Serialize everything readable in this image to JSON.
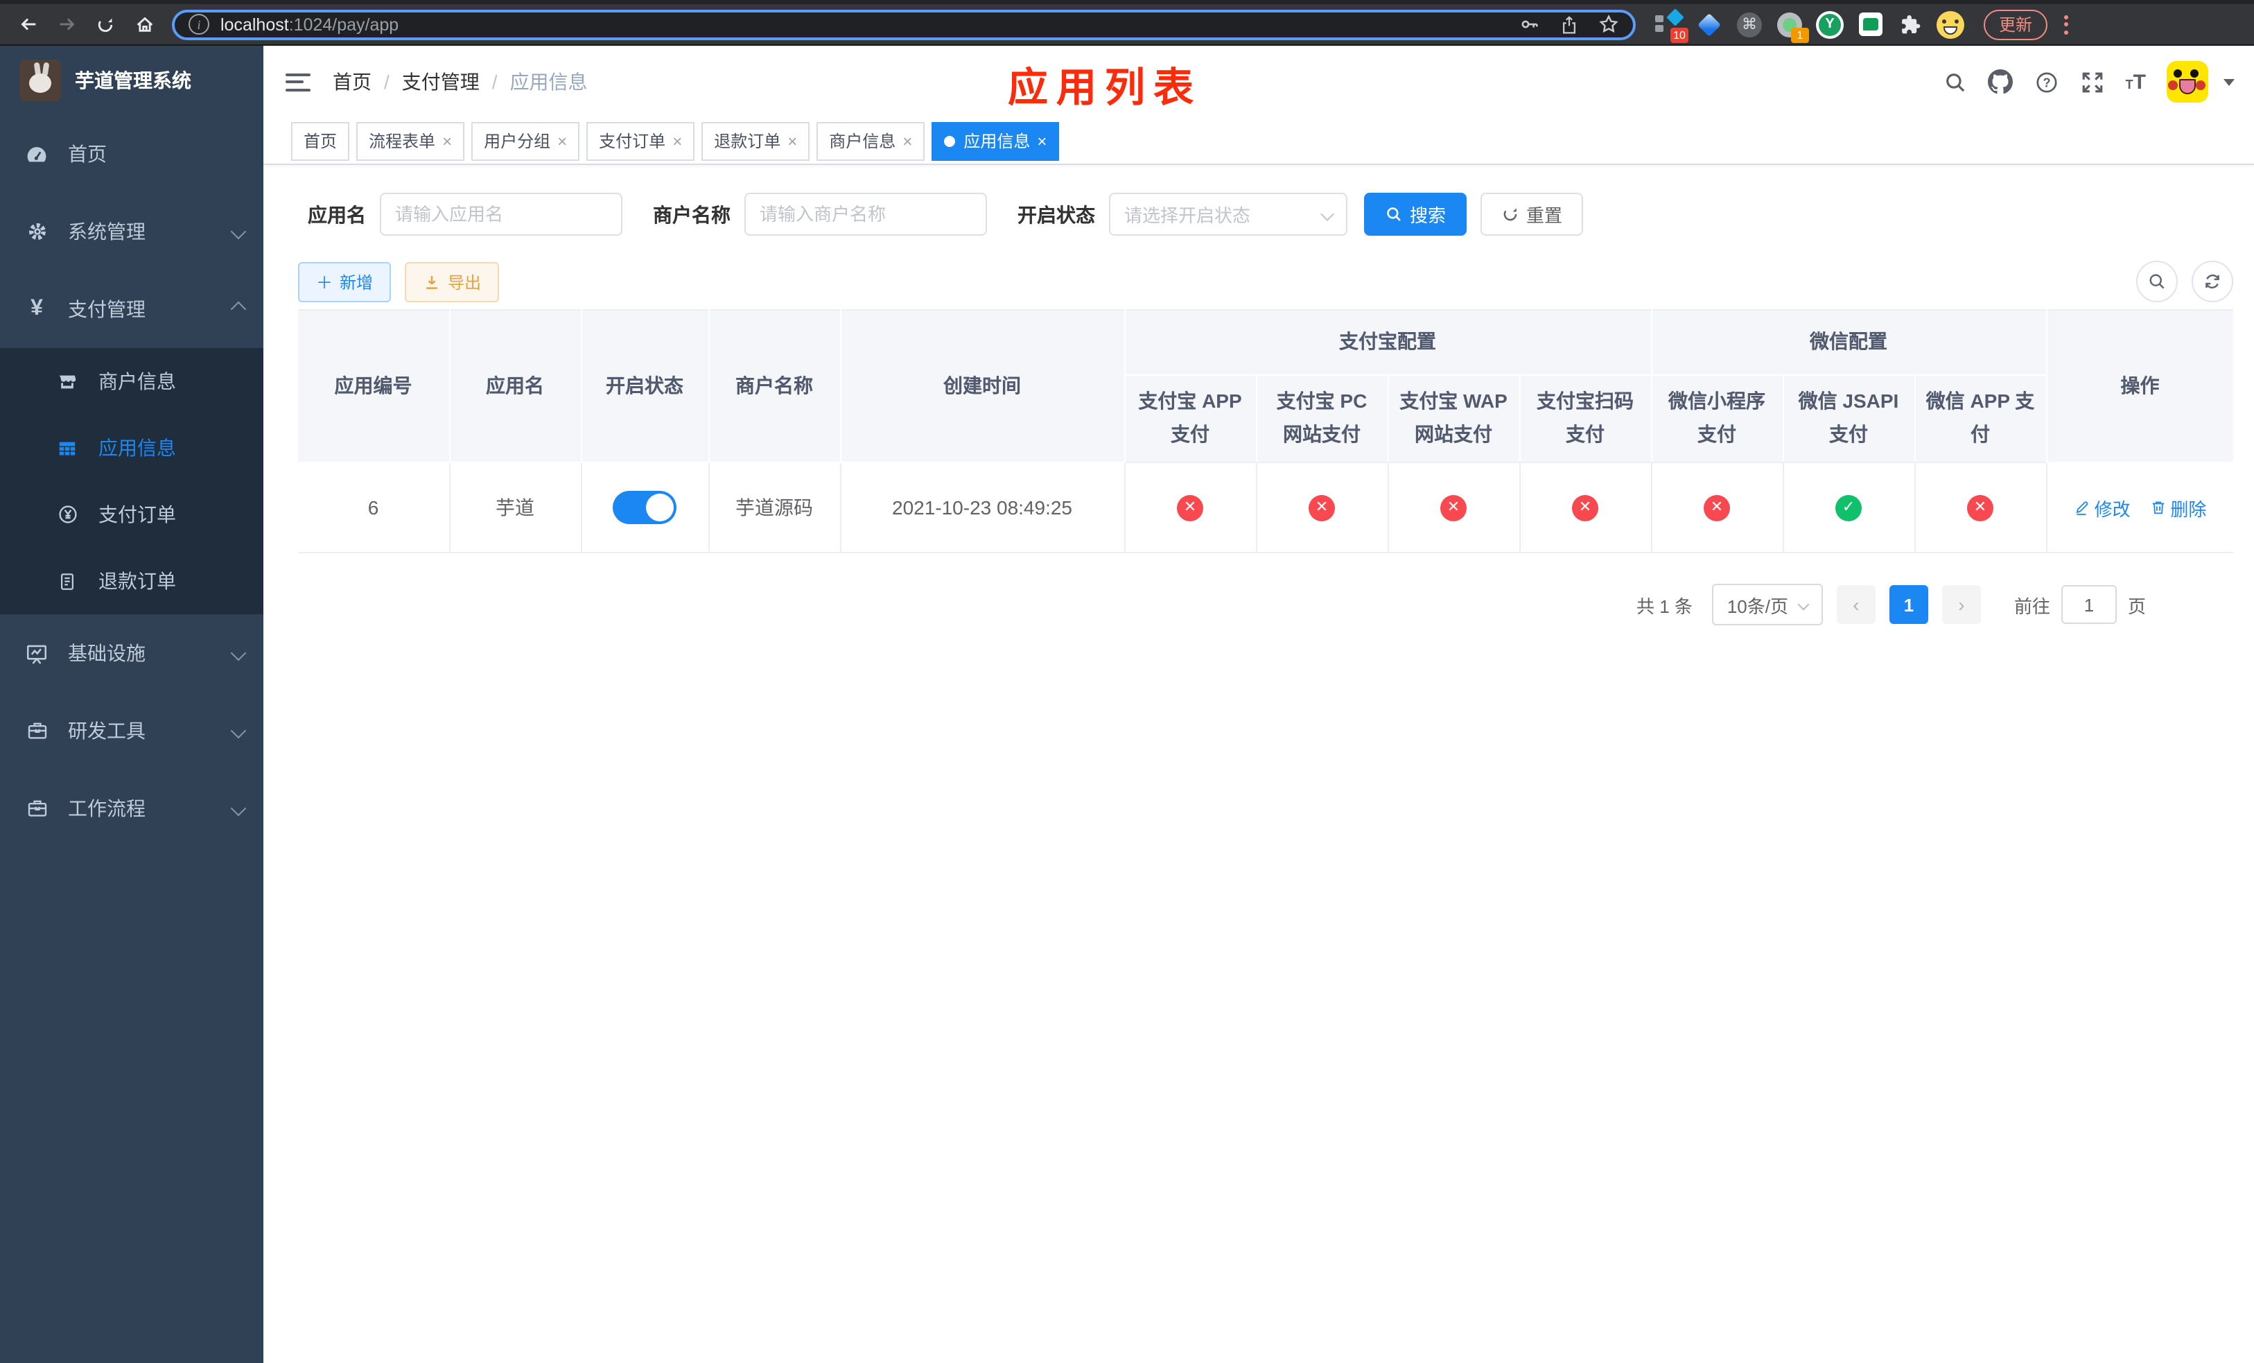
{
  "colors": {
    "primary": "#1b87f2",
    "danger": "#f7494f",
    "success": "#11c06a",
    "warning": "#e6a23c",
    "annotation": "#fb2c0c"
  },
  "ui": {
    "close_glyph": "×",
    "check_glyph": "✓",
    "cross_glyph": "✕",
    "breadcrumb_sep": "/",
    "prev_glyph": "‹",
    "next_glyph": "›",
    "cmd_glyph": "⌘",
    "plus_glyph": "＋",
    "info_glyph": "i",
    "help_glyph": "?",
    "font_icon_small": "T",
    "font_icon_big": "T",
    "yen_glyph": "¥"
  },
  "chrome": {
    "url_host": "localhost",
    "url_path": ":1024/pay/app",
    "ext_badge_blue": "10",
    "ext_badge_green": "1",
    "ext_y_label": "Y",
    "update_label": "更新"
  },
  "sidebar": {
    "title": "芋道管理系统",
    "menu_top": [
      {
        "label": "首页",
        "icon": "dashboard-icon"
      },
      {
        "label": "系统管理",
        "icon": "gear-icon"
      },
      {
        "label": "支付管理",
        "icon": "yen-icon"
      }
    ],
    "submenu": [
      {
        "label": "商户信息",
        "icon": "shop-icon"
      },
      {
        "label": "应用信息",
        "icon": "grid-icon"
      },
      {
        "label": "支付订单",
        "icon": "yen-circle-icon"
      },
      {
        "label": "退款订单",
        "icon": "document-icon"
      }
    ],
    "menu_bottom": [
      {
        "label": "基础设施",
        "icon": "monitor-icon"
      },
      {
        "label": "研发工具",
        "icon": "briefcase-icon"
      },
      {
        "label": "工作流程",
        "icon": "briefcase-icon"
      }
    ]
  },
  "navbar": {
    "breadcrumb": [
      "首页",
      "支付管理",
      "应用信息"
    ],
    "annotation": "应用列表"
  },
  "tabs": [
    {
      "label": "首页"
    },
    {
      "label": "流程表单"
    },
    {
      "label": "用户分组"
    },
    {
      "label": "支付订单"
    },
    {
      "label": "退款订单"
    },
    {
      "label": "商户信息"
    },
    {
      "label": "应用信息"
    }
  ],
  "filters": {
    "app_name_label": "应用名",
    "app_name_placeholder": "请输入应用名",
    "merchant_label": "商户名称",
    "merchant_placeholder": "请输入商户名称",
    "status_label": "开启状态",
    "status_placeholder": "请选择开启状态",
    "search_label": "搜索",
    "reset_label": "重置"
  },
  "toolbar": {
    "add_label": "新增",
    "export_label": "导出"
  },
  "table": {
    "columns": [
      "应用编号",
      "应用名",
      "开启状态",
      "商户名称",
      "创建时间"
    ],
    "alipay_group": {
      "label": "支付宝配置",
      "children": [
        "支付宝 APP 支付",
        "支付宝 PC 网站支付",
        "支付宝 WAP 网站支付",
        "支付宝扫码支付"
      ]
    },
    "wechat_group": {
      "label": "微信配置",
      "children": [
        "微信小程序支付",
        "微信 JSAPI 支付",
        "微信 APP 支付"
      ]
    },
    "actions_label": "操作",
    "row": {
      "id": "6",
      "name": "芋道",
      "enabled": true,
      "merchant": "芋道源码",
      "created_at": "2021-10-23 08:49:25",
      "statuses": [
        "no",
        "no",
        "no",
        "no",
        "no",
        "yes",
        "no"
      ],
      "edit_label": "修改",
      "delete_label": "删除"
    }
  },
  "pagination": {
    "total": "共 1 条",
    "page_size": "10条/页",
    "page": "1",
    "goto_label": "前往",
    "goto_value": "1",
    "page_unit": "页"
  }
}
